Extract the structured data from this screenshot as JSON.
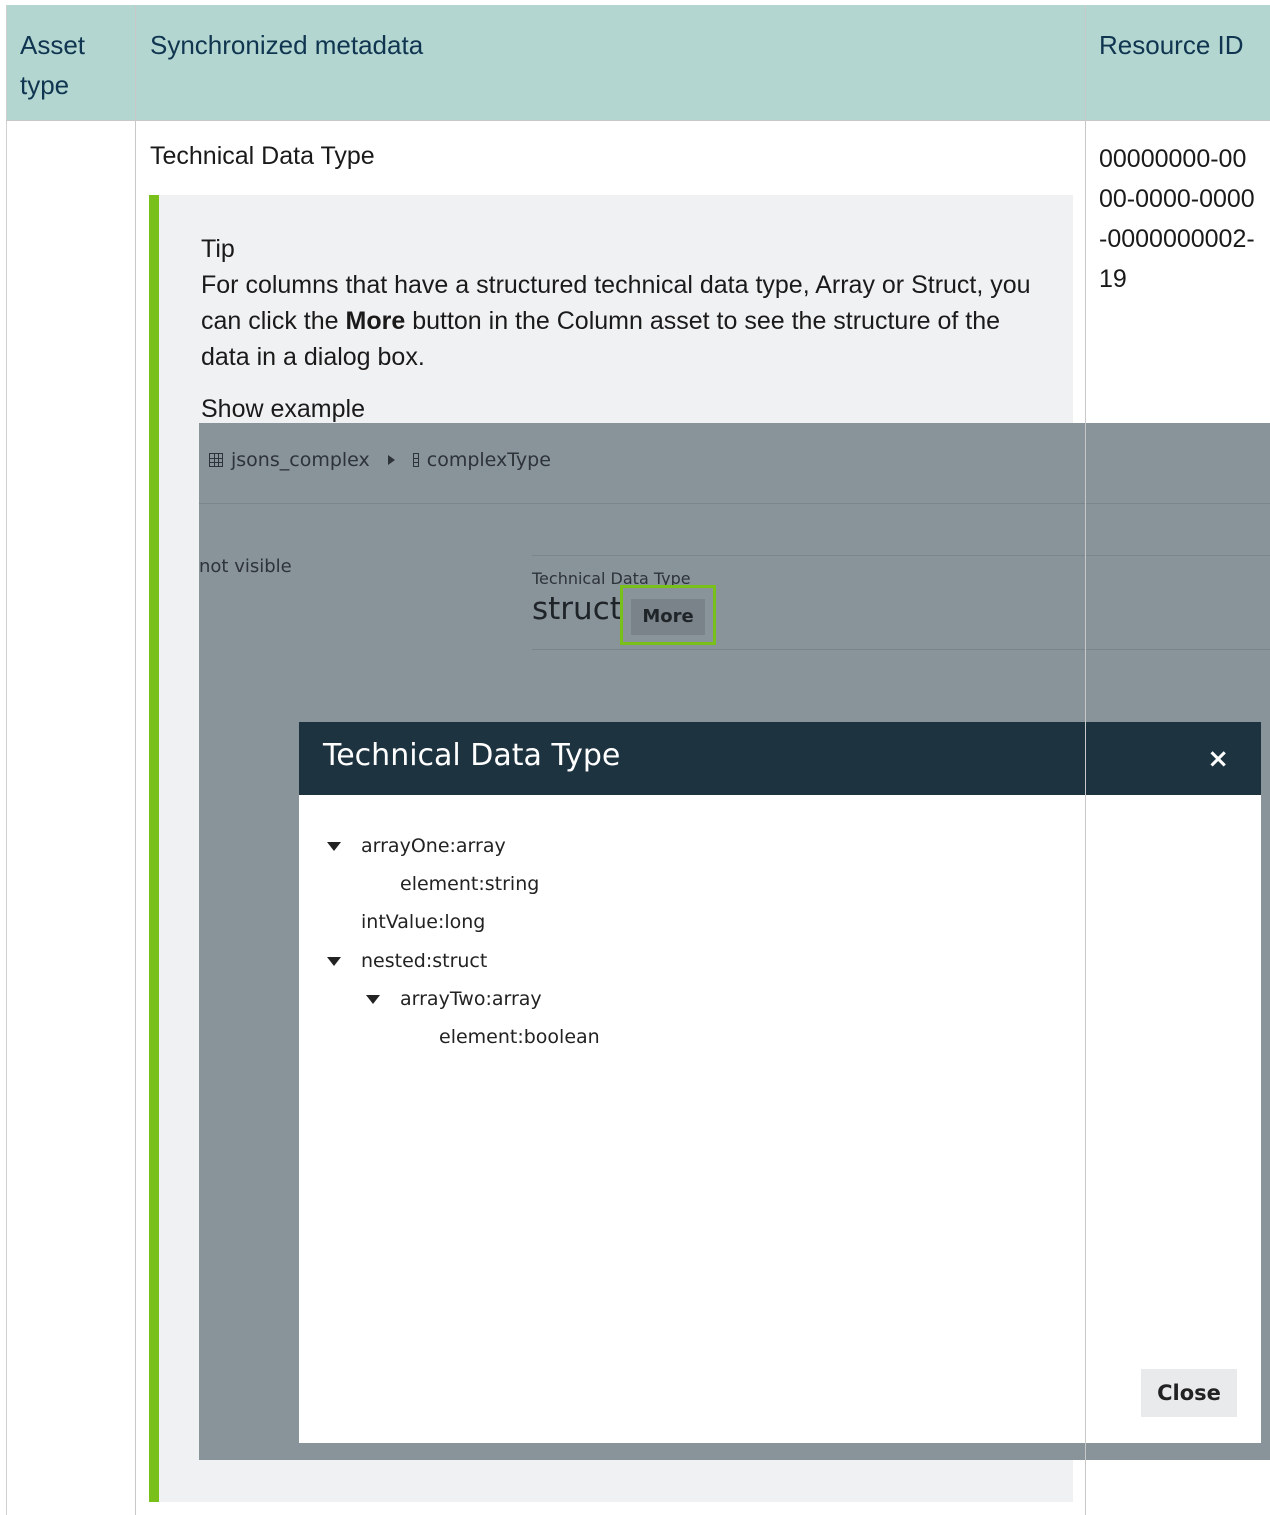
{
  "table": {
    "headers": {
      "asset_type": "Asset type",
      "synchronized_metadata": "Synchronized metadata",
      "resource_id": "Resource ID"
    },
    "row": {
      "asset_type": "",
      "metadata_title": "Technical Data Type",
      "resource_id": "00000000-0000-0000-0000-0000000002-19"
    }
  },
  "tip": {
    "label": "Tip",
    "text_before": "For columns that have a structured technical data type, Array or Struct, you can click the ",
    "text_bold": "More",
    "text_after": " button in the Column asset to see the structure of the data in a dialog box.",
    "show_example": "Show example",
    "accent_color": "#7ac01a"
  },
  "example": {
    "breadcrumb": {
      "table_name": "jsons_complex",
      "column_name": "complexType"
    },
    "not_visible": "not visible",
    "field_label": "Technical Data Type",
    "field_value": "struct",
    "more_button": "More",
    "dialog": {
      "title": "Technical Data Type",
      "close_x": "×",
      "tree": [
        {
          "label": "arrayOne:array",
          "expanded": true
        },
        {
          "label": "element:string"
        },
        {
          "label": "intValue:long"
        },
        {
          "label": "nested:struct",
          "expanded": true
        },
        {
          "label": "arrayTwo:array",
          "expanded": true
        },
        {
          "label": "element:boolean"
        }
      ],
      "close_button": "Close"
    }
  }
}
